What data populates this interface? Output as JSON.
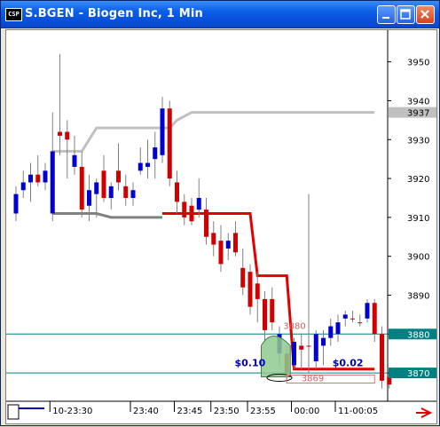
{
  "window": {
    "app_icon": "csp-app-icon",
    "app_icon_text": "CSP",
    "title": "S.BGEN - Biogen Inc, 1 Min",
    "buttons": [
      "minimize",
      "maximize",
      "close"
    ]
  },
  "chart_data": {
    "type": "candlestick",
    "symbol": "S.BGEN",
    "ylim": [
      3865,
      3957
    ],
    "y_ticks": [
      3870,
      3880,
      3890,
      3900,
      3910,
      3920,
      3930,
      3940,
      3950
    ],
    "x_ticks": [
      "10-23:30",
      "23:40",
      "23:45",
      "23:50",
      "23:55",
      "00:00",
      "11-00:05"
    ],
    "price_tags": [
      {
        "label": "3937",
        "value": 3937,
        "color": "#c0c0c0"
      },
      {
        "label": "3880",
        "value": 3880,
        "color": "#008080"
      },
      {
        "label": "3870",
        "value": 3870,
        "color": "#008080"
      }
    ],
    "horizontal_lines": [
      3880,
      3870
    ],
    "candles": [
      {
        "o": 3916,
        "h": 3918,
        "l": 3909,
        "c": 3911,
        "color": "blue"
      },
      {
        "o": 3919,
        "h": 3922,
        "l": 3915,
        "c": 3917,
        "color": "blue"
      },
      {
        "o": 3919,
        "h": 3924,
        "l": 3914,
        "c": 3921,
        "color": "blue"
      },
      {
        "o": 3921,
        "h": 3926,
        "l": 3918,
        "c": 3919,
        "color": "red"
      },
      {
        "o": 3919,
        "h": 3924,
        "l": 3917,
        "c": 3922,
        "color": "blue"
      },
      {
        "o": 3927,
        "h": 3937,
        "l": 3909,
        "c": 3911,
        "color": "blue"
      },
      {
        "o": 3931,
        "h": 3952,
        "l": 3926,
        "c": 3932,
        "color": "red"
      },
      {
        "o": 3932,
        "h": 3935,
        "l": 3920,
        "c": 3930,
        "color": "red"
      },
      {
        "o": 3926,
        "h": 3931,
        "l": 3921,
        "c": 3923,
        "color": "blue"
      },
      {
        "o": 3923,
        "h": 3927,
        "l": 3910,
        "c": 3912,
        "color": "red"
      },
      {
        "o": 3917,
        "h": 3921,
        "l": 3909,
        "c": 3913,
        "color": "blue"
      },
      {
        "o": 3916,
        "h": 3920,
        "l": 3910,
        "c": 3919,
        "color": "blue"
      },
      {
        "o": 3922,
        "h": 3926,
        "l": 3914,
        "c": 3915,
        "color": "red"
      },
      {
        "o": 3915,
        "h": 3919,
        "l": 3912,
        "c": 3918,
        "color": "blue"
      },
      {
        "o": 3922,
        "h": 3929,
        "l": 3917,
        "c": 3919,
        "color": "red"
      },
      {
        "o": 3918,
        "h": 3921,
        "l": 3913,
        "c": 3915,
        "color": "red"
      },
      {
        "o": 3917,
        "h": 3919,
        "l": 3913,
        "c": 3915,
        "color": "blue"
      },
      {
        "o": 3924,
        "h": 3928,
        "l": 3921,
        "c": 3922,
        "color": "blue"
      },
      {
        "o": 3924,
        "h": 3930,
        "l": 3920,
        "c": 3923,
        "color": "blue"
      },
      {
        "o": 3925,
        "h": 3932,
        "l": 3920,
        "c": 3928,
        "color": "blue"
      },
      {
        "o": 3938,
        "h": 3941,
        "l": 3924,
        "c": 3926,
        "color": "blue"
      },
      {
        "o": 3938,
        "h": 3940,
        "l": 3918,
        "c": 3920,
        "color": "red"
      },
      {
        "o": 3919,
        "h": 3922,
        "l": 3911,
        "c": 3914,
        "color": "red"
      },
      {
        "o": 3914,
        "h": 3916,
        "l": 3908,
        "c": 3910,
        "color": "red"
      },
      {
        "o": 3913,
        "h": 3915,
        "l": 3908,
        "c": 3909,
        "color": "red"
      },
      {
        "o": 3915,
        "h": 3920,
        "l": 3910,
        "c": 3912,
        "color": "blue"
      },
      {
        "o": 3912,
        "h": 3915,
        "l": 3903,
        "c": 3905,
        "color": "red"
      },
      {
        "o": 3906,
        "h": 3909,
        "l": 3900,
        "c": 3903,
        "color": "red"
      },
      {
        "o": 3904,
        "h": 3908,
        "l": 3896,
        "c": 3898,
        "color": "red"
      },
      {
        "o": 3902,
        "h": 3906,
        "l": 3899,
        "c": 3904,
        "color": "blue"
      },
      {
        "o": 3906,
        "h": 3909,
        "l": 3900,
        "c": 3901,
        "color": "red"
      },
      {
        "o": 3897,
        "h": 3902,
        "l": 3890,
        "c": 3892,
        "color": "red"
      },
      {
        "o": 3896,
        "h": 3898,
        "l": 3885,
        "c": 3887,
        "color": "red"
      },
      {
        "o": 3893,
        "h": 3896,
        "l": 3883,
        "c": 3889,
        "color": "red"
      },
      {
        "o": 3889,
        "h": 3891,
        "l": 3878,
        "c": 3881,
        "color": "red"
      },
      {
        "o": 3883,
        "h": 3892,
        "l": 3881,
        "c": 3889,
        "color": "red"
      },
      {
        "o": 3880,
        "h": 3882,
        "l": 3872,
        "c": 3875,
        "color": "blue"
      },
      {
        "o": 3875,
        "h": 3877,
        "l": 3868,
        "c": 3870,
        "color": "red"
      },
      {
        "o": 3872,
        "h": 3879,
        "l": 3871,
        "c": 3878,
        "color": "blue"
      },
      {
        "o": 3877,
        "h": 3880,
        "l": 3871,
        "c": 3876,
        "color": "red"
      },
      {
        "o": 3877,
        "h": 3916,
        "l": 3870,
        "c": 3877,
        "color": "red"
      },
      {
        "o": 3873,
        "h": 3881,
        "l": 3871,
        "c": 3880,
        "color": "blue"
      },
      {
        "o": 3879,
        "h": 3881,
        "l": 3872,
        "c": 3877,
        "color": "blue"
      },
      {
        "o": 3879,
        "h": 3884,
        "l": 3877,
        "c": 3882,
        "color": "blue"
      },
      {
        "o": 3880,
        "h": 3885,
        "l": 3878,
        "c": 3883,
        "color": "blue"
      },
      {
        "o": 3884,
        "h": 3886,
        "l": 3882,
        "c": 3885,
        "color": "blue"
      },
      {
        "o": 3884,
        "h": 3886,
        "l": 3883,
        "c": 3884,
        "color": "red"
      },
      {
        "o": 3883,
        "h": 3885,
        "l": 3882,
        "c": 3883,
        "color": "red"
      },
      {
        "o": 3884,
        "h": 3889,
        "l": 3883,
        "c": 3888,
        "color": "blue"
      },
      {
        "o": 3888,
        "h": 3889,
        "l": 3878,
        "c": 3880,
        "color": "red"
      },
      {
        "o": 3880,
        "h": 3882,
        "l": 3866,
        "c": 3868,
        "color": "red"
      },
      {
        "o": 3869,
        "h": 3871,
        "l": 3866,
        "c": 3867,
        "color": "red"
      }
    ],
    "annotations": [
      {
        "text": "3880",
        "color": "#d06060"
      },
      {
        "text": "3869",
        "color": "#d06060"
      },
      {
        "text": "$0.10",
        "color": "#0000c0"
      },
      {
        "text": "$0.02",
        "color": "#0000c0"
      }
    ],
    "gray_stop_line": [
      3927,
      3927,
      3933,
      3933,
      3933,
      3933,
      3935,
      3937,
      3937
    ],
    "red_stop_line": [
      3911,
      3911,
      3911,
      3895,
      3895,
      3871,
      3871,
      3871
    ]
  }
}
